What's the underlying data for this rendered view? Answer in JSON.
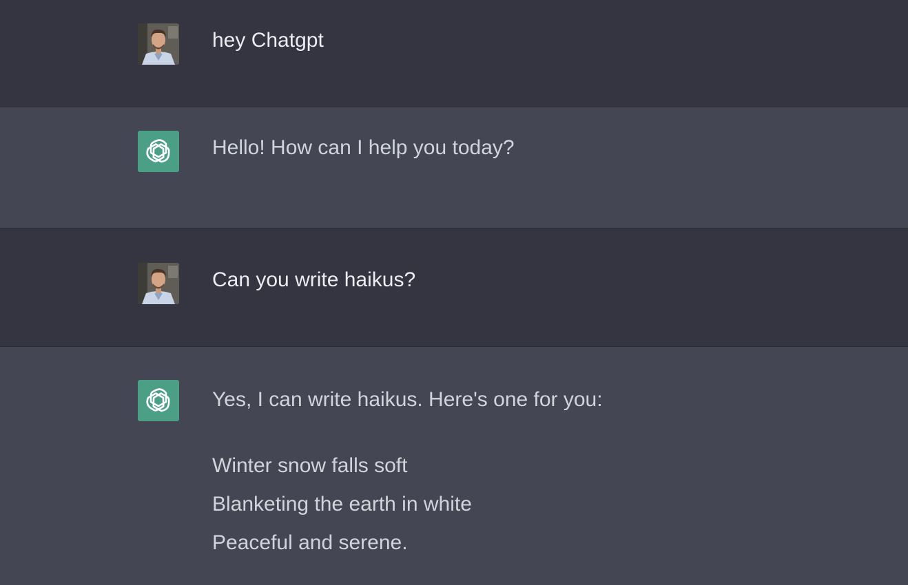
{
  "messages": [
    {
      "role": "user",
      "text": "hey Chatgpt",
      "avatar_icon": "user-photo-avatar"
    },
    {
      "role": "assistant",
      "text": "Hello! How can I help you today?",
      "avatar_icon": "openai-logo-icon"
    },
    {
      "role": "user",
      "text": "Can you write haikus?",
      "avatar_icon": "user-photo-avatar"
    },
    {
      "role": "assistant",
      "text": "Yes, I can write haikus. Here's one for you:",
      "avatar_icon": "openai-logo-icon",
      "poem": [
        "Winter snow falls soft",
        "Blanketing the earth in white",
        "Peaceful and serene."
      ]
    }
  ],
  "colors": {
    "user_bg": "#343541",
    "assistant_bg": "#444654",
    "bot_avatar": "#4a9f85"
  }
}
